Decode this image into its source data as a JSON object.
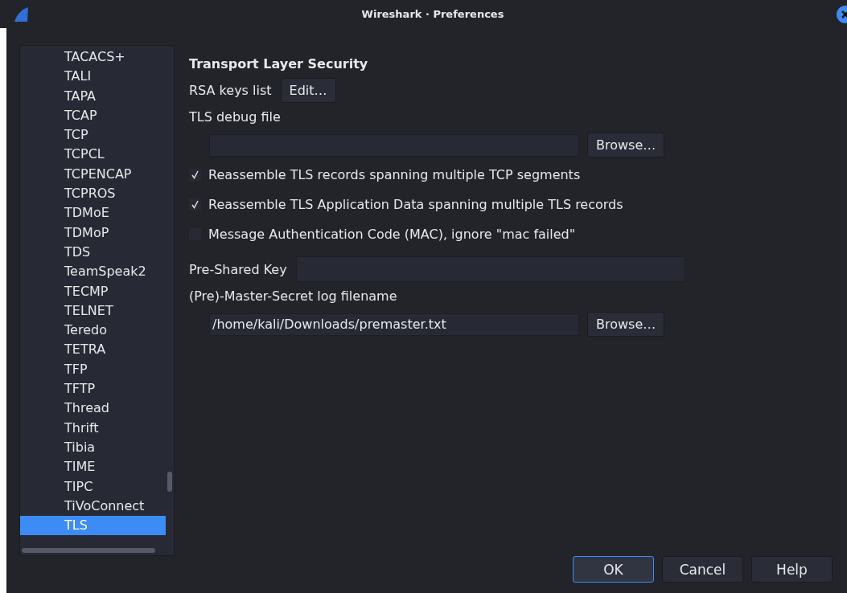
{
  "window": {
    "title": "Wireshark · Preferences"
  },
  "sidebar": {
    "items": [
      {
        "label": "TACACS+",
        "selected": false
      },
      {
        "label": "TALI",
        "selected": false
      },
      {
        "label": "TAPA",
        "selected": false
      },
      {
        "label": "TCAP",
        "selected": false
      },
      {
        "label": "TCP",
        "selected": false
      },
      {
        "label": "TCPCL",
        "selected": false
      },
      {
        "label": "TCPENCAP",
        "selected": false
      },
      {
        "label": "TCPROS",
        "selected": false
      },
      {
        "label": "TDMoE",
        "selected": false
      },
      {
        "label": "TDMoP",
        "selected": false
      },
      {
        "label": "TDS",
        "selected": false
      },
      {
        "label": "TeamSpeak2",
        "selected": false
      },
      {
        "label": "TECMP",
        "selected": false
      },
      {
        "label": "TELNET",
        "selected": false
      },
      {
        "label": "Teredo",
        "selected": false
      },
      {
        "label": "TETRA",
        "selected": false
      },
      {
        "label": "TFP",
        "selected": false
      },
      {
        "label": "TFTP",
        "selected": false
      },
      {
        "label": "Thread",
        "selected": false
      },
      {
        "label": "Thrift",
        "selected": false
      },
      {
        "label": "Tibia",
        "selected": false
      },
      {
        "label": "TIME",
        "selected": false
      },
      {
        "label": "TIPC",
        "selected": false
      },
      {
        "label": "TiVoConnect",
        "selected": false
      },
      {
        "label": "TLS",
        "selected": true
      }
    ]
  },
  "panel": {
    "title": "Transport Layer Security",
    "rsa_keys": {
      "label": "RSA keys list",
      "button": "Edit…"
    },
    "debug_file": {
      "label": "TLS debug file",
      "button": "Browse…"
    },
    "options": [
      {
        "label": "Reassemble TLS records spanning multiple TCP segments",
        "checked": true
      },
      {
        "label": "Reassemble TLS Application Data spanning multiple TLS records",
        "checked": true
      },
      {
        "label": "Message Authentication Code (MAC), ignore \"mac failed\"",
        "checked": false
      }
    ],
    "psk": {
      "label": "Pre-Shared Key"
    },
    "keylog": {
      "label": "(Pre)-Master-Secret log filename",
      "value": "/home/kali/Downloads/premaster.txt",
      "button": "Browse…"
    }
  },
  "buttons": [
    {
      "label": "OK",
      "default": true
    },
    {
      "label": "Cancel",
      "default": false
    },
    {
      "label": "Help",
      "default": false
    }
  ]
}
